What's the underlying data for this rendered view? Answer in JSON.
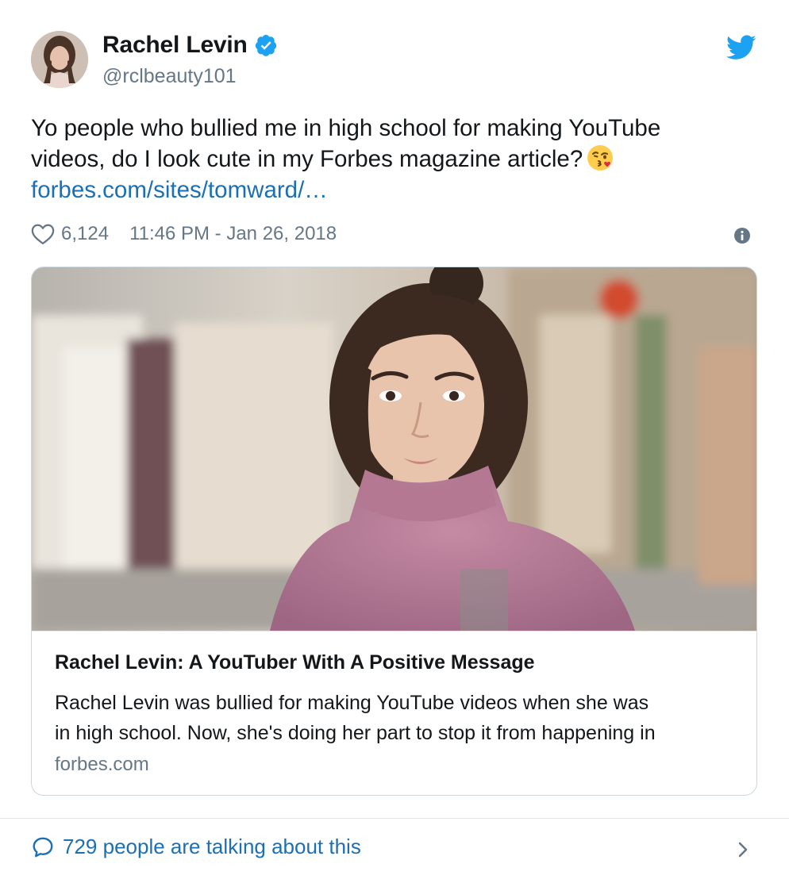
{
  "author": {
    "display_name": "Rachel Levin",
    "handle": "@rclbeauty101",
    "verified": true,
    "avatar_icon": "profile-photo"
  },
  "tweet": {
    "text_line_1": "Yo people who bullied me in high school for making YouTube",
    "text_line_2": "videos, do I look cute in my Forbes magazine article?",
    "emoji": "face-throwing-a-kiss",
    "link_text": "forbes.com/sites/tomward/…",
    "like_count": "6,124",
    "timestamp": "11:46 PM - Jan 26, 2018"
  },
  "card": {
    "title": "Rachel Levin: A YouTuber With A Positive Message",
    "description_line_1": "Rachel Levin was bullied for making YouTube videos when she was",
    "description_line_2": "in high school. Now, she's doing her part to stop it from happening in",
    "domain": "forbes.com"
  },
  "footer": {
    "talking_text": "729 people are talking about this"
  },
  "colors": {
    "link": "#1b6fb5",
    "secondary_text": "#657786",
    "twitter_blue": "#1da1f2",
    "border": "#ccd6dd"
  }
}
